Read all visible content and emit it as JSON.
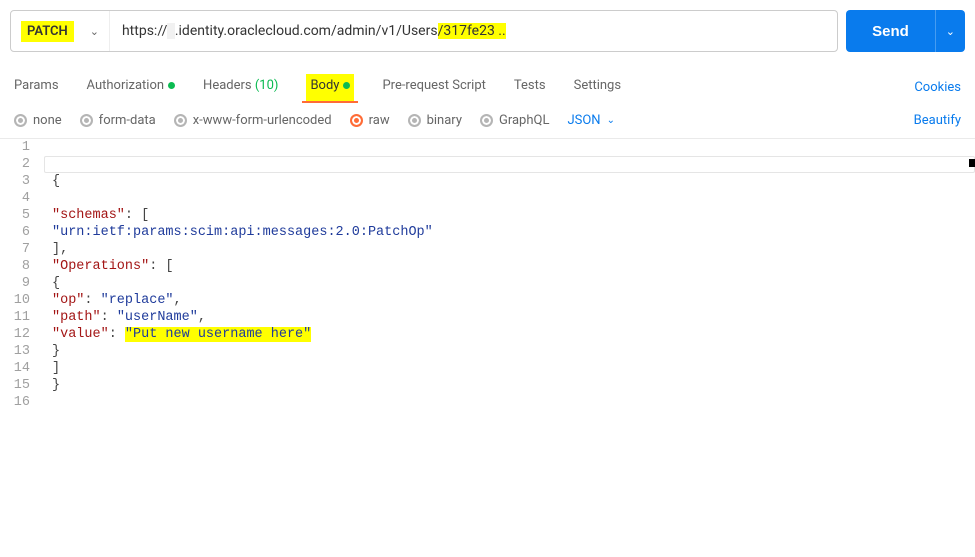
{
  "request": {
    "method": "PATCH",
    "url_prefix": "https://",
    "url_greyed": "                                                         ",
    "url_mid": ".identity.oraclecloud.com/admin/v1/Users",
    "url_hl": "/317fe23 ..",
    "send_label": "Send"
  },
  "tabs": {
    "params": "Params",
    "authorization": "Authorization",
    "headers_prefix": "Headers ",
    "headers_count": "(10)",
    "body": "Body",
    "prerequest": "Pre-request Script",
    "tests": "Tests",
    "settings": "Settings",
    "cookies": "Cookies"
  },
  "body_types": {
    "none": "none",
    "formdata": "form-data",
    "xwww": "x-www-form-urlencoded",
    "raw": "raw",
    "binary": "binary",
    "graphql": "GraphQL",
    "format_select": "JSON",
    "beautify": "Beautify"
  },
  "editor": {
    "lines": [
      {
        "n": 1,
        "indent": "",
        "tokens": []
      },
      {
        "n": 2,
        "indent": "",
        "tokens": [],
        "current": true
      },
      {
        "n": 3,
        "indent": "",
        "tokens": [
          {
            "t": "punc",
            "v": "{"
          }
        ]
      },
      {
        "n": 4,
        "indent": "",
        "tokens": []
      },
      {
        "n": 5,
        "indent": "",
        "tokens": [
          {
            "t": "key",
            "v": "\"schemas\""
          },
          {
            "t": "punc",
            "v": ": ["
          }
        ]
      },
      {
        "n": 6,
        "indent": "",
        "tokens": [
          {
            "t": "str",
            "v": "\"urn:ietf:params:scim:api:messages:2.0:PatchOp\""
          }
        ]
      },
      {
        "n": 7,
        "indent": "",
        "tokens": [
          {
            "t": "punc",
            "v": "],"
          }
        ]
      },
      {
        "n": 8,
        "indent": "",
        "tokens": [
          {
            "t": "key",
            "v": "\"Operations\""
          },
          {
            "t": "punc",
            "v": ": ["
          }
        ]
      },
      {
        "n": 9,
        "indent": "",
        "tokens": [
          {
            "t": "punc",
            "v": "{"
          }
        ]
      },
      {
        "n": 10,
        "indent": "",
        "tokens": [
          {
            "t": "key",
            "v": "\"op\""
          },
          {
            "t": "punc",
            "v": ": "
          },
          {
            "t": "str",
            "v": "\"replace\""
          },
          {
            "t": "punc",
            "v": ","
          }
        ]
      },
      {
        "n": 11,
        "indent": "",
        "tokens": [
          {
            "t": "key",
            "v": "\"path\""
          },
          {
            "t": "punc",
            "v": ": "
          },
          {
            "t": "str",
            "v": "\"userName\""
          },
          {
            "t": "punc",
            "v": ","
          }
        ]
      },
      {
        "n": 12,
        "indent": "",
        "tokens": [
          {
            "t": "key",
            "v": "\"value\""
          },
          {
            "t": "punc",
            "v": ": "
          },
          {
            "t": "strhl",
            "v": "\"Put new username here\""
          }
        ]
      },
      {
        "n": 13,
        "indent": "",
        "tokens": [
          {
            "t": "punc",
            "v": "}"
          }
        ]
      },
      {
        "n": 14,
        "indent": "",
        "tokens": [
          {
            "t": "punc",
            "v": "]"
          }
        ]
      },
      {
        "n": 15,
        "indent": "",
        "tokens": [
          {
            "t": "punc",
            "v": "}"
          }
        ]
      },
      {
        "n": 16,
        "indent": "",
        "tokens": []
      }
    ]
  }
}
